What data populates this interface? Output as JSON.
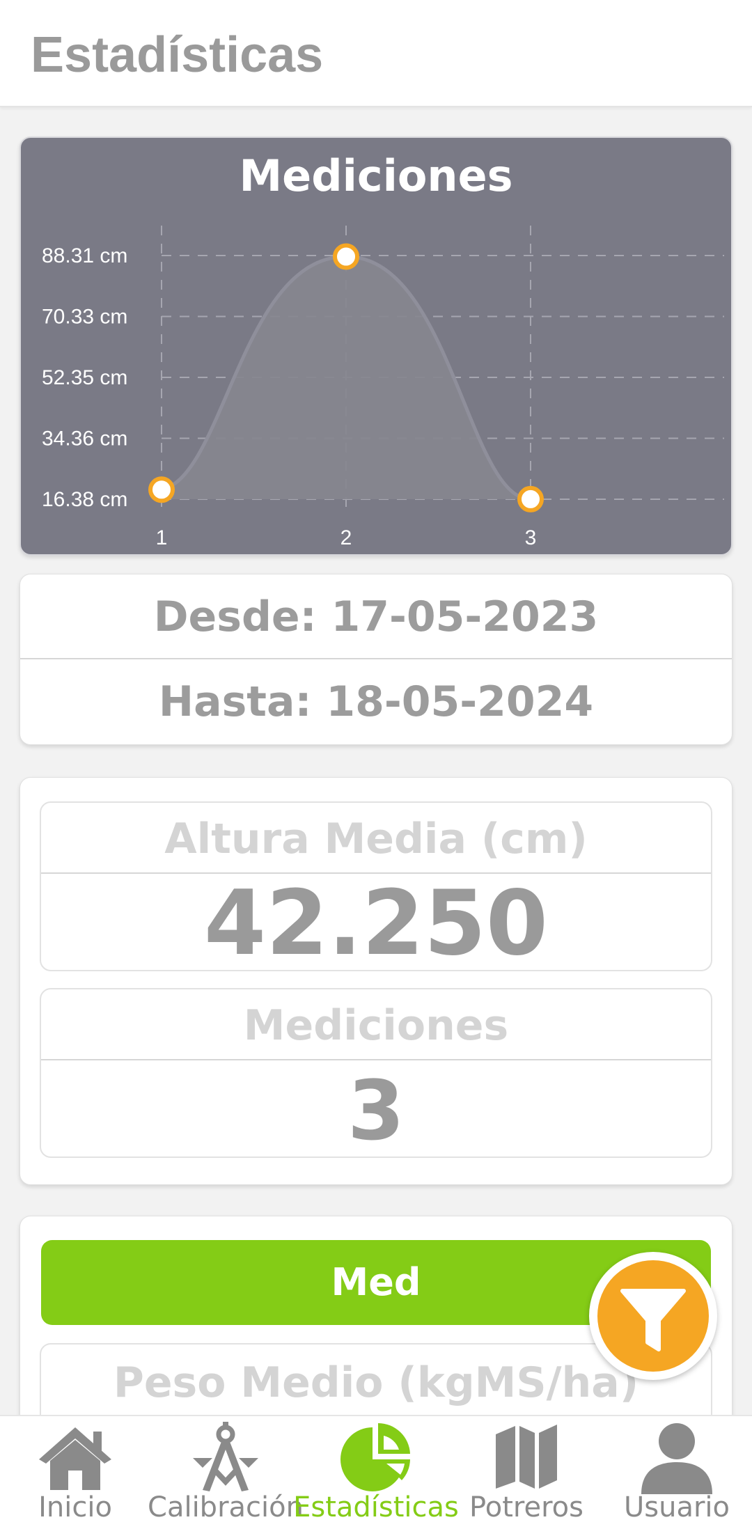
{
  "header": {
    "title": "Estadísticas"
  },
  "chart_data": {
    "type": "line",
    "title": "Mediciones",
    "x": [
      1,
      2,
      3
    ],
    "categories": [
      "1",
      "2",
      "3"
    ],
    "values": [
      19.2,
      88.0,
      16.4
    ],
    "y_tick_labels": [
      "88.31 cm",
      "70.33 cm",
      "52.35 cm",
      "34.36 cm",
      "16.38 cm"
    ],
    "y_ticks": [
      88.31,
      70.33,
      52.35,
      34.36,
      16.38
    ],
    "ylim": [
      16.38,
      88.31
    ],
    "xlabel": "",
    "ylabel": "",
    "grid": true,
    "line_color": "#8f8f9b",
    "point_fill": "#ffffff",
    "point_stroke": "#f5a623"
  },
  "dates": {
    "desde": "Desde: 17-05-2023",
    "hasta": "Hasta: 18-05-2024"
  },
  "stats": {
    "altura_label": "Altura Media (cm)",
    "altura_value": "42.250",
    "mediciones_label": "Mediciones",
    "mediciones_value": "3"
  },
  "lower": {
    "med_button": "Med",
    "peso_label": "Peso Medio (kgMS/ha)"
  },
  "fab": {
    "icon": "filter-icon",
    "color": "#f5a623"
  },
  "nav": {
    "items": [
      {
        "label": "Inicio",
        "icon": "home-icon"
      },
      {
        "label": "Calibración",
        "icon": "compass-icon"
      },
      {
        "label": "Estadísticas",
        "icon": "pie-chart-icon"
      },
      {
        "label": "Potreros",
        "icon": "map-icon"
      },
      {
        "label": "Usuario",
        "icon": "user-icon"
      }
    ],
    "active_color": "#84cc16",
    "inactive_color": "#8a8a8a"
  }
}
